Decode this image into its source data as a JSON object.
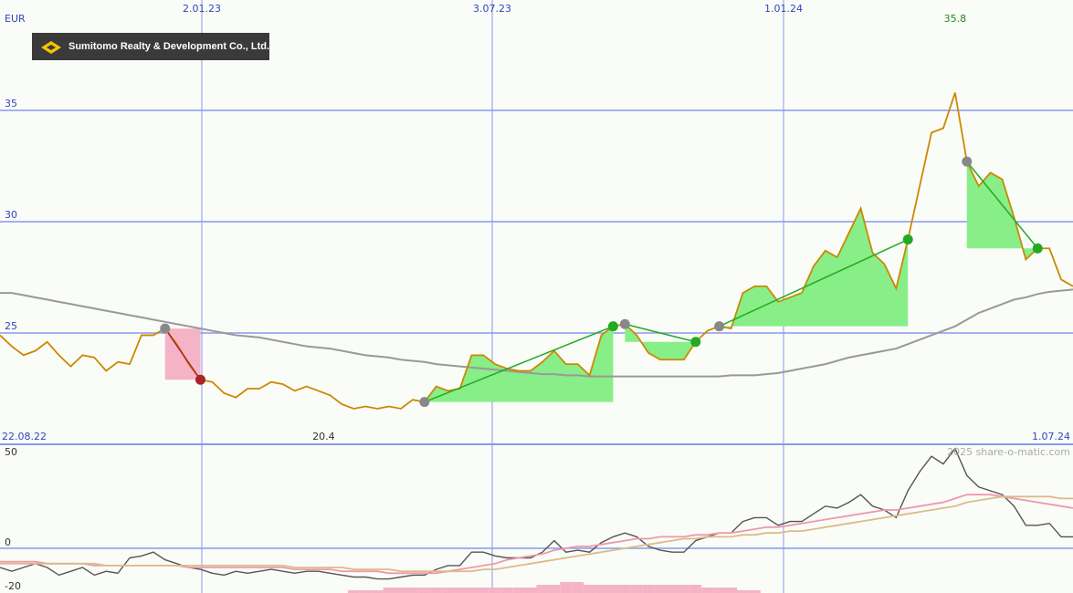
{
  "company": "Sumitomo Realty & Development Co., Ltd.",
  "currency": "EUR",
  "watermark": "2025 share-o-matic.com",
  "colors": {
    "background": "#fafcf8",
    "grid": "#8899ee",
    "price": "#cc8800",
    "ma_long": "#999999",
    "gain_fill": "#88ee88",
    "loss_fill": "#f5b3c8",
    "trend_up": "#22aa22",
    "trend_down": "#aa2222",
    "osc_main": "#555555",
    "osc_pink": "#ee99aa",
    "osc_tan": "#ddbb88",
    "histogram": "#f5b3c8"
  },
  "chart_data": [
    {
      "type": "line",
      "currency_label": "EUR",
      "x_ticks": [
        "2.01.23",
        "3.07.23",
        "1.01.24"
      ],
      "y_ticks": [
        25,
        30,
        35
      ],
      "ylim": [
        19.5,
        37
      ],
      "start_label": "22.08.22",
      "end_label": "1.07.24",
      "min_label": "20.4",
      "max_label": "35.8",
      "series": [
        {
          "role": "price",
          "values": [
            24.9,
            24.4,
            24.0,
            24.2,
            24.6,
            24.0,
            23.5,
            24.0,
            23.9,
            23.3,
            23.7,
            23.6,
            24.9,
            24.9,
            25.2,
            24.5,
            23.6,
            22.9,
            22.8,
            22.3,
            22.1,
            22.5,
            22.5,
            22.8,
            22.7,
            22.4,
            22.6,
            22.4,
            22.2,
            21.8,
            21.6,
            21.7,
            21.6,
            21.7,
            21.6,
            22.0,
            21.9,
            22.6,
            22.4,
            22.5,
            24.0,
            24.0,
            23.6,
            23.4,
            23.3,
            23.3,
            23.7,
            24.2,
            23.6,
            23.6,
            23.1,
            24.9,
            25.3,
            25.4,
            24.9,
            24.1,
            23.8,
            23.8,
            23.8,
            24.6,
            25.1,
            25.3,
            25.2,
            26.8,
            27.1,
            27.1,
            26.4,
            26.6,
            26.8,
            28.0,
            28.7,
            28.4,
            29.5,
            30.6,
            28.6,
            28.1,
            27.0,
            29.2,
            31.6,
            34.0,
            34.2,
            35.8,
            32.7,
            31.6,
            32.2,
            31.9,
            30.2,
            28.3,
            28.8,
            28.8,
            27.4,
            27.1
          ]
        },
        {
          "role": "moving-average",
          "values": [
            26.8,
            26.8,
            26.7,
            26.6,
            26.5,
            26.4,
            26.3,
            26.2,
            26.1,
            26.0,
            25.9,
            25.8,
            25.7,
            25.6,
            25.5,
            25.4,
            25.3,
            25.2,
            25.1,
            25.0,
            24.9,
            24.85,
            24.8,
            24.7,
            24.6,
            24.5,
            24.4,
            24.35,
            24.3,
            24.2,
            24.1,
            24.0,
            23.95,
            23.9,
            23.8,
            23.75,
            23.7,
            23.6,
            23.55,
            23.5,
            23.45,
            23.4,
            23.35,
            23.3,
            23.25,
            23.2,
            23.15,
            23.15,
            23.1,
            23.1,
            23.05,
            23.05,
            23.05,
            23.05,
            23.05,
            23.05,
            23.05,
            23.05,
            23.05,
            23.05,
            23.05,
            23.05,
            23.1,
            23.1,
            23.1,
            23.15,
            23.2,
            23.3,
            23.4,
            23.5,
            23.6,
            23.75,
            23.9,
            24.0,
            24.1,
            24.2,
            24.3,
            24.5,
            24.7,
            24.9,
            25.1,
            25.3,
            25.6,
            25.9,
            26.1,
            26.3,
            26.5,
            26.6,
            26.75,
            26.85,
            26.9,
            26.95
          ]
        }
      ],
      "trades": [
        {
          "start_index": 14,
          "end_index": 17,
          "result": "loss"
        },
        {
          "start_index": 36,
          "end_index": 52,
          "result": "gain"
        },
        {
          "start_index": 53,
          "end_index": 59,
          "result": "gain"
        },
        {
          "start_index": 61,
          "end_index": 77,
          "result": "gain"
        },
        {
          "start_index": 82,
          "end_index": 88,
          "result": "gain"
        }
      ]
    },
    {
      "type": "line",
      "y_ticks": [
        -20,
        0,
        50
      ],
      "ylim": [
        -20,
        55
      ],
      "series": [
        {
          "role": "oscillator",
          "values": [
            -10,
            -12,
            -10,
            -8,
            -10,
            -14,
            -12,
            -10,
            -14,
            -12,
            -13,
            -5,
            -4,
            -2,
            -6,
            -8,
            -10,
            -11,
            -13,
            -14,
            -12,
            -13,
            -12,
            -11,
            -12,
            -13,
            -12,
            -12,
            -13,
            -14,
            -15,
            -15,
            -16,
            -16,
            -15,
            -14,
            -14,
            -11,
            -9,
            -9,
            -2,
            -2,
            -4,
            -5,
            -5,
            -5,
            -2,
            4,
            -2,
            -1,
            -2,
            3,
            6,
            8,
            6,
            1,
            -1,
            -2,
            -2,
            4,
            6,
            8,
            8,
            14,
            16,
            16,
            12,
            14,
            14,
            18,
            22,
            21,
            24,
            28,
            22,
            20,
            16,
            30,
            40,
            48,
            44,
            52,
            38,
            32,
            30,
            28,
            22,
            12,
            12,
            13,
            6,
            6
          ]
        },
        {
          "role": "signal-pink",
          "values": [
            -7,
            -7,
            -7,
            -7,
            -8,
            -8,
            -8,
            -8,
            -9,
            -9,
            -9,
            -9,
            -9,
            -9,
            -9,
            -9,
            -10,
            -10,
            -10,
            -10,
            -10,
            -10,
            -10,
            -10,
            -10,
            -11,
            -11,
            -11,
            -11,
            -12,
            -12,
            -12,
            -12,
            -13,
            -13,
            -13,
            -13,
            -13,
            -12,
            -11,
            -10,
            -9,
            -8,
            -6,
            -5,
            -4,
            -3,
            -1,
            0,
            1,
            1,
            2,
            3,
            4,
            5,
            5,
            6,
            6,
            6,
            7,
            7,
            8,
            8,
            9,
            10,
            11,
            11,
            12,
            13,
            14,
            15,
            16,
            17,
            18,
            19,
            20,
            20,
            21,
            22,
            23,
            24,
            26,
            28,
            28,
            28,
            27,
            26,
            25,
            24,
            23,
            22,
            21
          ]
        },
        {
          "role": "signal-tan",
          "values": [
            -8,
            -8,
            -8,
            -8,
            -8,
            -8,
            -8,
            -8,
            -8,
            -9,
            -9,
            -9,
            -9,
            -9,
            -9,
            -9,
            -9,
            -9,
            -9,
            -9,
            -9,
            -9,
            -9,
            -9,
            -9,
            -10,
            -10,
            -10,
            -10,
            -10,
            -11,
            -11,
            -11,
            -11,
            -12,
            -12,
            -12,
            -12,
            -12,
            -12,
            -12,
            -11,
            -11,
            -10,
            -9,
            -8,
            -7,
            -6,
            -5,
            -4,
            -3,
            -2,
            -1,
            0,
            1,
            2,
            3,
            4,
            5,
            5,
            6,
            6,
            6,
            7,
            7,
            8,
            8,
            9,
            9,
            10,
            11,
            12,
            13,
            14,
            15,
            16,
            17,
            18,
            19,
            20,
            21,
            22,
            24,
            25,
            26,
            27,
            27,
            27,
            27,
            27,
            26,
            26
          ]
        },
        {
          "role": "histogram",
          "values": [
            0,
            0,
            0,
            0,
            0,
            0,
            0,
            0,
            0,
            0,
            0,
            0,
            0,
            0,
            0,
            0,
            0,
            0,
            0,
            0,
            0,
            0,
            0,
            0,
            0,
            0,
            0,
            0,
            0,
            0,
            1,
            1,
            1,
            2,
            2,
            2,
            2,
            2,
            2,
            2,
            2,
            2,
            2,
            2,
            2,
            2,
            3,
            3,
            4,
            4,
            3,
            3,
            3,
            3,
            3,
            3,
            3,
            3,
            3,
            3,
            2,
            2,
            2,
            1,
            1,
            0,
            0,
            0,
            0,
            0,
            0,
            0,
            0,
            0,
            0,
            0,
            0,
            0,
            0,
            0,
            0,
            0,
            0,
            0,
            0,
            0,
            0,
            0,
            0,
            0,
            0,
            0
          ]
        }
      ]
    }
  ]
}
